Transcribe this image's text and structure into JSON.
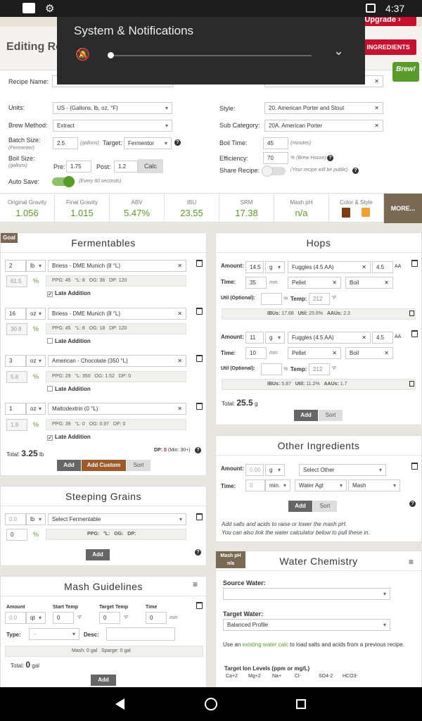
{
  "status_bar": {
    "time": "4:37"
  },
  "overlay": {
    "title": "System & Notifications"
  },
  "header": {
    "title": "Editing Re",
    "upgrade_label": "Upgrade ›",
    "buying_label": "Y INGREDIENTS",
    "brew_tag": "Brew!"
  },
  "form": {
    "recipe_name_label": "Recipe Name:",
    "units_label": "Units:",
    "units_value": "US - (Gallons, lb, oz, °F)",
    "brew_method_label": "Brew Method:",
    "brew_method_value": "Extract",
    "batch_size_label": "Batch Size:",
    "batch_size_sub": "(Fermenter)",
    "batch_size_value": "2.5",
    "batch_unit": "(gallons)",
    "target_label": "Target:",
    "target_value": "Fermentor",
    "boil_size_label": "Boil Size:",
    "boil_size_sub": "(gallons)",
    "pre_label": "Pre:",
    "pre_value": "1.75",
    "post_label": "Post:",
    "post_value": "1.2",
    "calc_label": "Calc",
    "auto_save_label": "Auto Save:",
    "auto_save_note": "(Every 60 seconds)",
    "style_label": "Style:",
    "style_value": "20. American Porter and Stout",
    "sub_category_label": "Sub Category:",
    "sub_category_value": "20A. American Porter",
    "boil_time_label": "Boil Time:",
    "boil_time_value": "45",
    "boil_time_unit": "(minutes)",
    "efficiency_label": "Efficiency:",
    "efficiency_value": "70",
    "efficiency_unit": "% (Brew House)",
    "share_label": "Share Recipe:",
    "share_note": "(Your recipe will be public)"
  },
  "stats": [
    {
      "label": "Original Gravity",
      "value": "1.056"
    },
    {
      "label": "Final Gravity",
      "value": "1.015"
    },
    {
      "label": "ABV",
      "value": "5.47%"
    },
    {
      "label": "IBU",
      "value": "23.55"
    },
    {
      "label": "SRM",
      "value": "17.38"
    },
    {
      "label": "Mash pH",
      "value": "n/a"
    },
    {
      "label": "Color & Style",
      "value": ""
    }
  ],
  "more_label": "MORE...",
  "fermentables": {
    "title": "Fermentables",
    "goal": "Goal",
    "items": [
      {
        "amount": "2",
        "unit": "lb",
        "name": "Briess - DME Munich (8 °L)",
        "pct": "61.5",
        "ppg": "45",
        "l": "8",
        "og": "36",
        "dp": "120",
        "late": true
      },
      {
        "amount": "16",
        "unit": "oz",
        "name": "Briess - DME Munich (8 °L)",
        "pct": "30.8",
        "ppg": "45",
        "l": "8",
        "og": "18",
        "dp": "120",
        "late": false
      },
      {
        "amount": "3",
        "unit": "oz",
        "name": "American - Chocolate (350 °L)",
        "pct": "5.8",
        "ppg": "29",
        "l": "350",
        "og": "1.52",
        "dp": "0",
        "late": false
      },
      {
        "amount": "1",
        "unit": "oz",
        "name": "Maltodextrin (0 °L)",
        "pct": "1.9",
        "ppg": "39",
        "l": "0",
        "og": "0.97",
        "dp": "0",
        "late": true
      }
    ],
    "late_label": "Late Addition",
    "total_label": "Total:",
    "total_value": "3.25",
    "total_unit": "lb",
    "dp_label": "DP:",
    "dp_value": "0",
    "dp_min": "(Min: 30+)",
    "add": "Add",
    "add_custom": "Add Custom",
    "sort": "Sort"
  },
  "hops": {
    "title": "Hops",
    "items": [
      {
        "amount": "14.5",
        "unit": "g",
        "name": "Fuggles (4.5 AA)",
        "aa": "4.5",
        "time": "35",
        "use": "Pellet",
        "type": "Boil",
        "temp": "212",
        "ibus": "17.68",
        "util": "25.6%",
        "aaus": "2.3"
      },
      {
        "amount": "11",
        "unit": "g",
        "name": "Fuggles (4.5 AA)",
        "aa": "4.5",
        "time": "10",
        "use": "Pellet",
        "type": "Boil",
        "temp": "212",
        "ibus": "5.87",
        "util": "11.2%",
        "aaus": "1.7"
      }
    ],
    "amount_label": "Amount:",
    "time_label": "Time:",
    "min_label": "min.",
    "util_opt_label": "Util (Optional):",
    "temp_label": "Temp:",
    "aa_label": "AA",
    "f_label": "°F",
    "pct_label": "%",
    "ibus_label": "IBUs:",
    "util_label": "Util:",
    "aaus_label": "AAUs:",
    "total_label": "Total:",
    "total_value": "25.5",
    "total_unit": "g",
    "add": "Add",
    "sort": "Sort"
  },
  "other": {
    "title": "Other Ingredients",
    "amount_label": "Amount:",
    "amount_placeholder": "0.00",
    "unit": "g",
    "select": "Select Other",
    "time_label": "Time:",
    "time_placeholder": "0",
    "min": "min.",
    "agent": "Water Agt",
    "stage": "Mash",
    "add": "Add",
    "sort": "Sort",
    "note1": "Add salts and acids to raise or lower the mash pH.",
    "note2": "You can also link the water calculator below to pull these in."
  },
  "steeping": {
    "title": "Steeping Grains",
    "amount_placeholder": "0.0",
    "unit": "lb",
    "select": "Select Fermentable",
    "pct": "0",
    "ppg_label": "PPG:",
    "l_label": "°L:",
    "og_label": "OG:",
    "dp_label": "DP:",
    "add": "Add"
  },
  "water": {
    "title": "Water Chemistry",
    "tag1": "Mash pH",
    "tag2": "n/a",
    "source_label": "Source Water:",
    "target_label": "Target Water:",
    "target_value": "Balanced Profile",
    "note_pre": "Use an ",
    "note_link": "existing water calc",
    "note_post": " to load salts and acids from a previous recipe.",
    "ions_label": "Target Ion Levels (ppm or mg/L)",
    "ions": [
      "Ca+2",
      "Mg+2",
      "Na+",
      "Cl-",
      "SO4-2",
      "HCO3-"
    ]
  },
  "mash": {
    "title": "Mash Guidelines",
    "amount_label": "Amount",
    "start_label": "Start Temp",
    "target_label": "Target Temp",
    "time_label": "Time",
    "amount_placeholder": "0.0",
    "unit": "qt",
    "start_value": "0",
    "target_value": "0",
    "time_value": "0",
    "f": "°F",
    "min": "min",
    "type_label": "Type:",
    "type_value": "--",
    "desc_label": "Desc:",
    "mash_line": "Mash: 0 gal",
    "sparge_line": "Sparge: 0 gal",
    "total_label": "Total:",
    "total_value": "0",
    "total_unit": "gal",
    "add": "Add"
  }
}
